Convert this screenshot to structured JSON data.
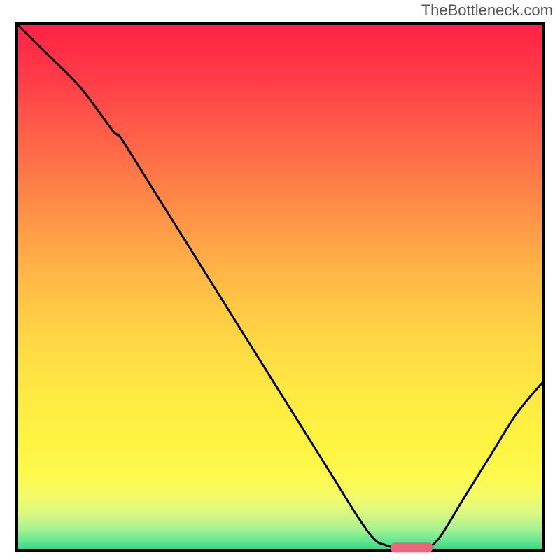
{
  "watermark": "TheBottleneck.com",
  "chart_data": {
    "type": "line",
    "title": "",
    "xlabel": "",
    "ylabel": "",
    "xlim": [
      0,
      100
    ],
    "ylim": [
      0,
      100
    ],
    "curve": [
      {
        "x": 0,
        "y": 100
      },
      {
        "x": 5,
        "y": 95
      },
      {
        "x": 12,
        "y": 88
      },
      {
        "x": 18,
        "y": 80
      },
      {
        "x": 19,
        "y": 79
      },
      {
        "x": 20,
        "y": 78
      },
      {
        "x": 25,
        "y": 70
      },
      {
        "x": 30,
        "y": 62
      },
      {
        "x": 35,
        "y": 54
      },
      {
        "x": 40,
        "y": 46
      },
      {
        "x": 45,
        "y": 38
      },
      {
        "x": 50,
        "y": 30
      },
      {
        "x": 55,
        "y": 22
      },
      {
        "x": 60,
        "y": 14
      },
      {
        "x": 65,
        "y": 6
      },
      {
        "x": 68,
        "y": 2
      },
      {
        "x": 70,
        "y": 1
      },
      {
        "x": 72,
        "y": 0.5
      },
      {
        "x": 75,
        "y": 0.5
      },
      {
        "x": 78,
        "y": 0.5
      },
      {
        "x": 80,
        "y": 2
      },
      {
        "x": 82,
        "y": 5
      },
      {
        "x": 85,
        "y": 10
      },
      {
        "x": 90,
        "y": 18
      },
      {
        "x": 95,
        "y": 26
      },
      {
        "x": 100,
        "y": 32
      }
    ],
    "marker": {
      "x": 75,
      "y": 0.5,
      "color": "#e8677a",
      "width": 8,
      "height": 2
    },
    "gradient_bands_top_to_bottom": [
      "#ff2247",
      "#ff4d4a",
      "#ff7549",
      "#ff9947",
      "#ffba45",
      "#ffd543",
      "#ffe742",
      "#fff341",
      "#f9f85d",
      "#e6f97c",
      "#c4f690",
      "#8fee96",
      "#4fe38e",
      "#2ed985"
    ]
  }
}
